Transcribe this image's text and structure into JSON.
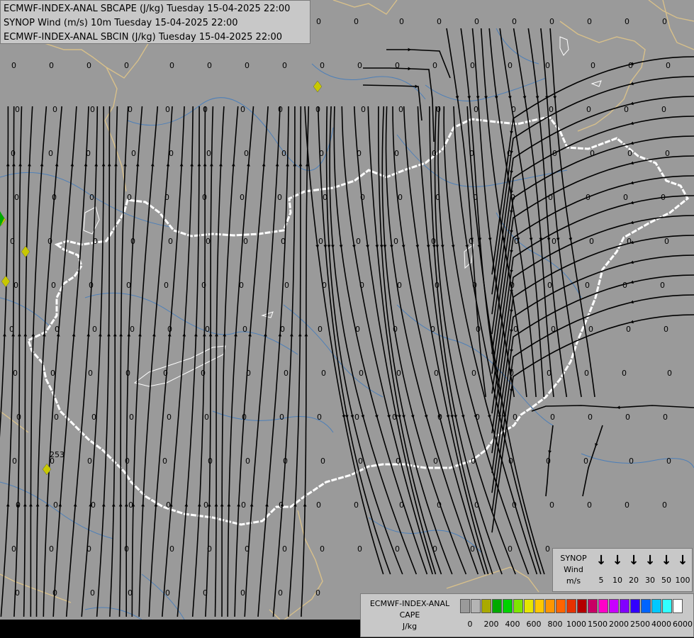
{
  "titles": {
    "line1": "ECMWF-INDEX-ANAL SBCAPE (J/kg) Tuesday 15-04-2025 22:00",
    "line2": "SYNOP Wind (m/s) 10m Tuesday 15-04-2025 22:00",
    "line3": "ECMWF-INDEX-ANAL SBCIN (J/kg) Tuesday 15-04-2025 22:00"
  },
  "colors": {
    "background": "#9a9a9a",
    "border_country": "#ffffff",
    "border_region": "#d8c08a",
    "rivers": "#4d7fb8",
    "streamlines": "#000000",
    "marker": "#c8c800"
  },
  "map_values": {
    "zero_label": "0",
    "highlight_label": "253"
  },
  "wind_legend": {
    "title_line1": "SYNOP",
    "title_line2": "Wind",
    "unit": "m/s",
    "values": [
      "5",
      "10",
      "20",
      "30",
      "50",
      "100"
    ],
    "arrow_glyph": "↓"
  },
  "cape_legend": {
    "title_line1": "ECMWF-INDEX-ANAL",
    "title_line2": "CAPE",
    "unit": "J/kg",
    "tick_labels": [
      "0",
      "200",
      "400",
      "600",
      "800",
      "1000",
      "1500",
      "2000",
      "2500",
      "4000",
      "6000"
    ],
    "swatch_colors": [
      "#9a9a9a",
      "#b4b4b4",
      "#aaaa00",
      "#00aa00",
      "#00d200",
      "#7fe600",
      "#e6e600",
      "#ffc800",
      "#ff9600",
      "#ff6400",
      "#e63200",
      "#b40000",
      "#c80064",
      "#ff00c8",
      "#c800ff",
      "#8200ff",
      "#3200ff",
      "#0064ff",
      "#00c8ff",
      "#32ffff",
      "#ffffff"
    ]
  }
}
